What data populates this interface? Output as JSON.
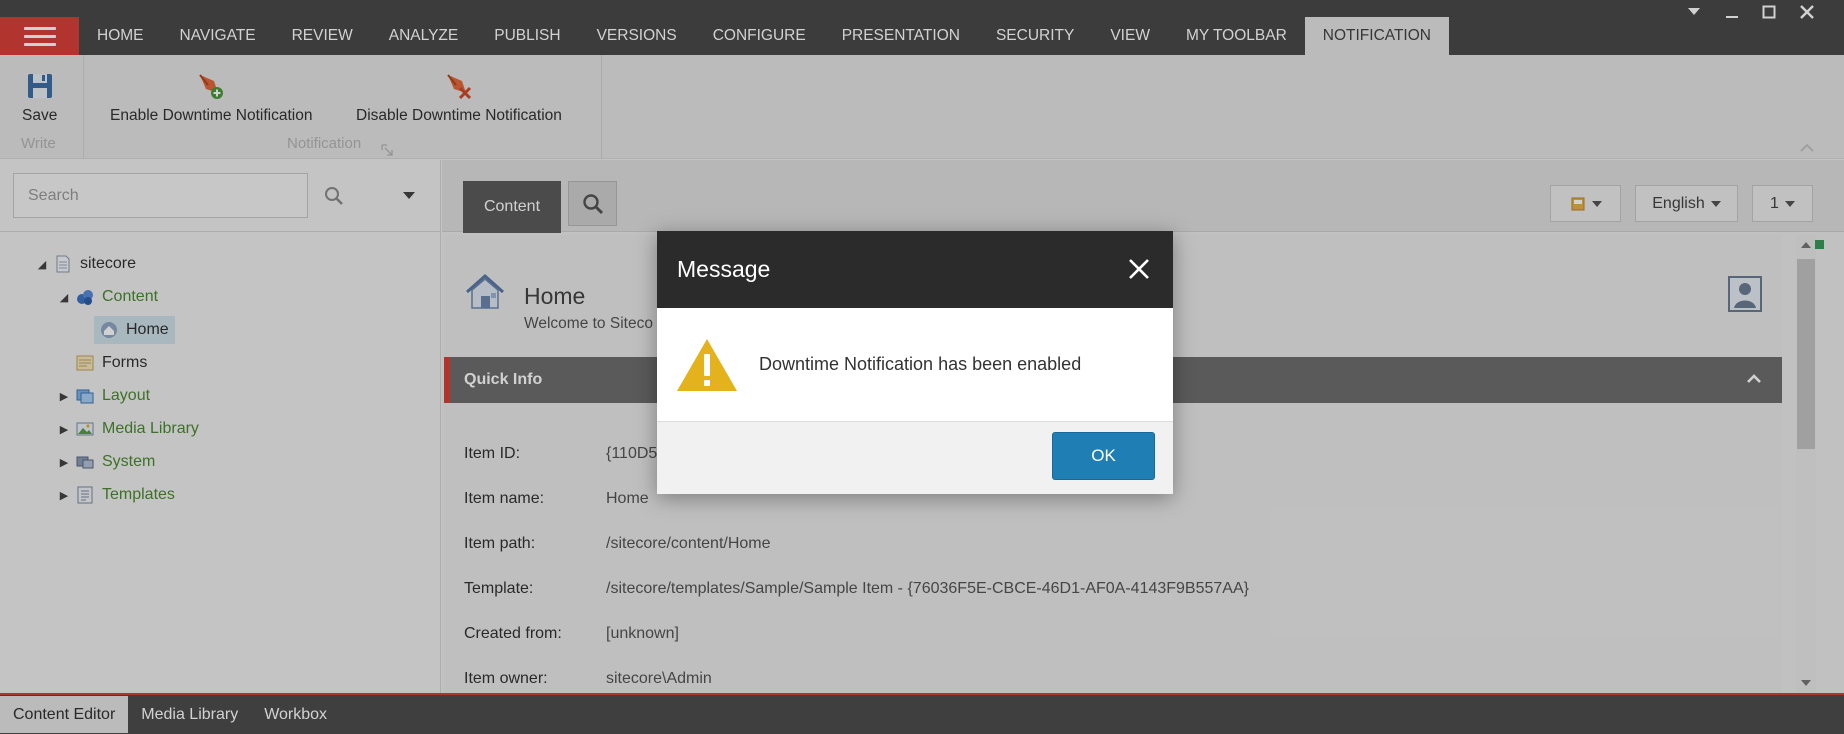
{
  "menu": {
    "tabs": [
      "HOME",
      "NAVIGATE",
      "REVIEW",
      "ANALYZE",
      "PUBLISH",
      "VERSIONS",
      "CONFIGURE",
      "PRESENTATION",
      "SECURITY",
      "VIEW",
      "MY TOOLBAR",
      "NOTIFICATION"
    ],
    "active_tab": "NOTIFICATION"
  },
  "ribbon": {
    "save_label": "Save",
    "write_group": "Write",
    "enable_label": "Enable Downtime Notification",
    "disable_label": "Disable Downtime Notification",
    "notification_group": "Notification"
  },
  "search": {
    "placeholder": "Search"
  },
  "tree": {
    "root": "sitecore",
    "content": "Content",
    "home": "Home",
    "forms": "Forms",
    "layout": "Layout",
    "media_library": "Media Library",
    "system": "System",
    "templates": "Templates"
  },
  "editor": {
    "content_tab": "Content",
    "language": "English",
    "version": "1",
    "item_title": "Home",
    "item_subtitle": "Welcome to Siteco",
    "quick_info": "Quick Info",
    "fields": [
      {
        "label": "Item ID:",
        "value": "{110D5"
      },
      {
        "label": "Item name:",
        "value": "Home"
      },
      {
        "label": "Item path:",
        "value": "/sitecore/content/Home"
      },
      {
        "label": "Template:",
        "value": "/sitecore/templates/Sample/Sample Item - {76036F5E-CBCE-46D1-AF0A-4143F9B557AA}"
      },
      {
        "label": "Created from:",
        "value": "[unknown]"
      },
      {
        "label": "Item owner:",
        "value": "sitecore\\Admin"
      }
    ]
  },
  "bottom_tabs": [
    "Content Editor",
    "Media Library",
    "Workbox"
  ],
  "dialog": {
    "title": "Message",
    "message": "Downtime Notification has been enabled",
    "ok_label": "OK"
  },
  "colors": {
    "accent_red": "#d9403a",
    "menu_bg": "#4a4a4a",
    "ok_blue": "#1f7fb5",
    "tree_green": "#4b8a31"
  }
}
